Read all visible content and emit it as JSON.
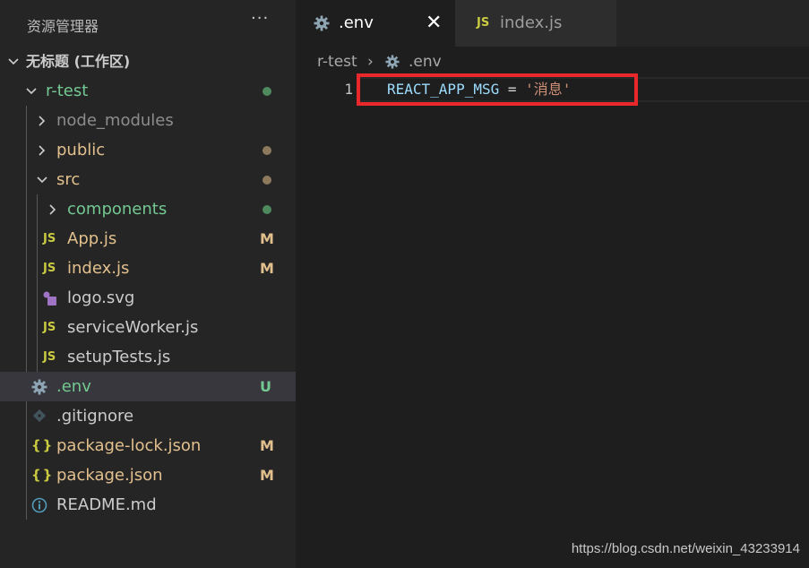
{
  "colors": {
    "untracked": "#73c991",
    "modified": "#e2c08d",
    "folder_default": "#cccccc",
    "ignored": "#8c8c8c",
    "js_icon": "#cbcb41",
    "gear_icon": "#8ea5b4",
    "json_icon": "#cbcb41",
    "info_icon": "#519aba",
    "svg_icon": "#a074c4",
    "highlight_box": "#e8282b"
  },
  "sidebar": {
    "title": "资源管理器",
    "more": "···",
    "items": [
      {
        "label": "无标题 (工作区)",
        "icon": "chevron-down-icon",
        "type": "workspace"
      },
      {
        "label": "r-test",
        "icon": "chevron-down-icon",
        "status": "dot"
      },
      {
        "label": "node_modules",
        "icon": "chevron-right-icon"
      },
      {
        "label": "public",
        "icon": "chevron-right-icon",
        "status": "dot"
      },
      {
        "label": "src",
        "icon": "chevron-down-icon",
        "status": "dot"
      },
      {
        "label": "components",
        "icon": "chevron-right-icon",
        "status": "dot"
      },
      {
        "label": "App.js",
        "icon": "js-icon",
        "icon_text": "JS",
        "status": "M"
      },
      {
        "label": "index.js",
        "icon": "js-icon",
        "icon_text": "JS",
        "status": "M"
      },
      {
        "label": "logo.svg",
        "icon": "svg-icon"
      },
      {
        "label": "serviceWorker.js",
        "icon": "js-icon",
        "icon_text": "JS"
      },
      {
        "label": "setupTests.js",
        "icon": "js-icon",
        "icon_text": "JS"
      },
      {
        "label": ".env",
        "icon": "gear-icon",
        "status": "U",
        "selected": true
      },
      {
        "label": ".gitignore",
        "icon": "git-icon"
      },
      {
        "label": "package-lock.json",
        "icon": "json-icon",
        "icon_text": "{}",
        "status": "M"
      },
      {
        "label": "package.json",
        "icon": "json-icon",
        "icon_text": "{}",
        "status": "M"
      },
      {
        "label": "README.md",
        "icon": "info-icon"
      }
    ]
  },
  "tabs": [
    {
      "label": ".env",
      "icon": "gear-icon",
      "active": true,
      "close": "✕"
    },
    {
      "label": "index.js",
      "icon": "js-icon",
      "icon_text": "JS",
      "active": false
    }
  ],
  "breadcrumb": {
    "folder": "r-test",
    "separator": "›",
    "file": ".env"
  },
  "editor": {
    "lines": [
      {
        "number": "1",
        "key": "REACT_APP_MSG",
        "op": " = ",
        "value": "'消息'"
      }
    ]
  },
  "watermark": "https://blog.csdn.net/weixin_43233914"
}
